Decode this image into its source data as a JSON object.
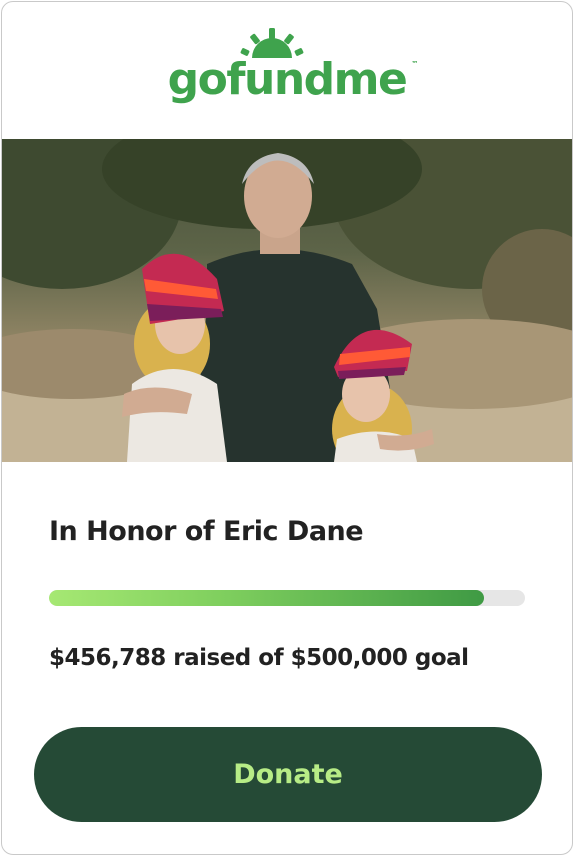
{
  "brand": {
    "logo_text": "gofundme",
    "trademark": "™",
    "color": "#3fa34d"
  },
  "campaign": {
    "title": "In Honor of Eric Dane",
    "raised_text": "$456,788 raised of $500,000 goal",
    "raised_value": 456788,
    "goal_value": 500000,
    "progress_fraction": 0.9136
  },
  "actions": {
    "donate_label": "Donate"
  },
  "colors": {
    "button_bg": "#254a36",
    "button_text": "#b7ec86",
    "progress_start": "#a6e873",
    "progress_end": "#3f9a44",
    "track": "#e6e6e6"
  }
}
